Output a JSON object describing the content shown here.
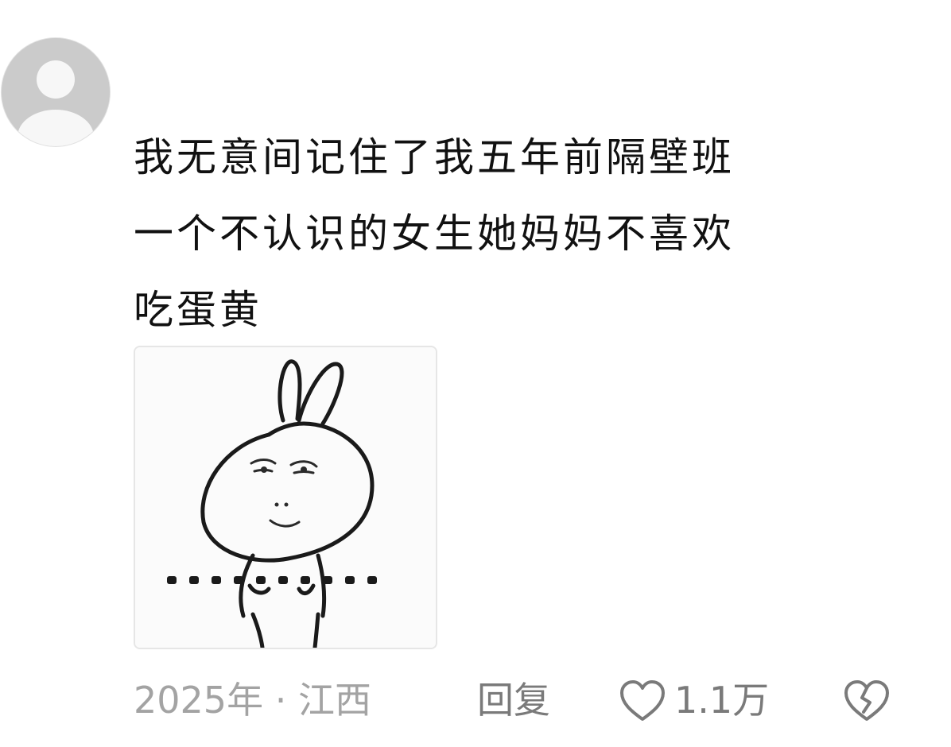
{
  "comment": {
    "avatar_icon": "default-user-avatar-icon",
    "text_lines": [
      "我无意间记住了我五年前隔壁班",
      "一个不认识的女生她妈妈不喜欢",
      "吃蛋黄"
    ],
    "sticker_icon": "bunny-meme-sticker",
    "footer": {
      "year": "2025年",
      "separator": "·",
      "location": "江西",
      "reply_label": "回复",
      "like_icon": "heart-outline-icon",
      "like_count": "1.1万",
      "dislike_icon": "broken-heart-icon"
    }
  },
  "colors": {
    "text": "#111111",
    "meta": "#a3a3a3",
    "action": "#7a7a7a",
    "avatar_bg": "#cbcbcb",
    "avatar_fg": "#f7f7f7"
  }
}
